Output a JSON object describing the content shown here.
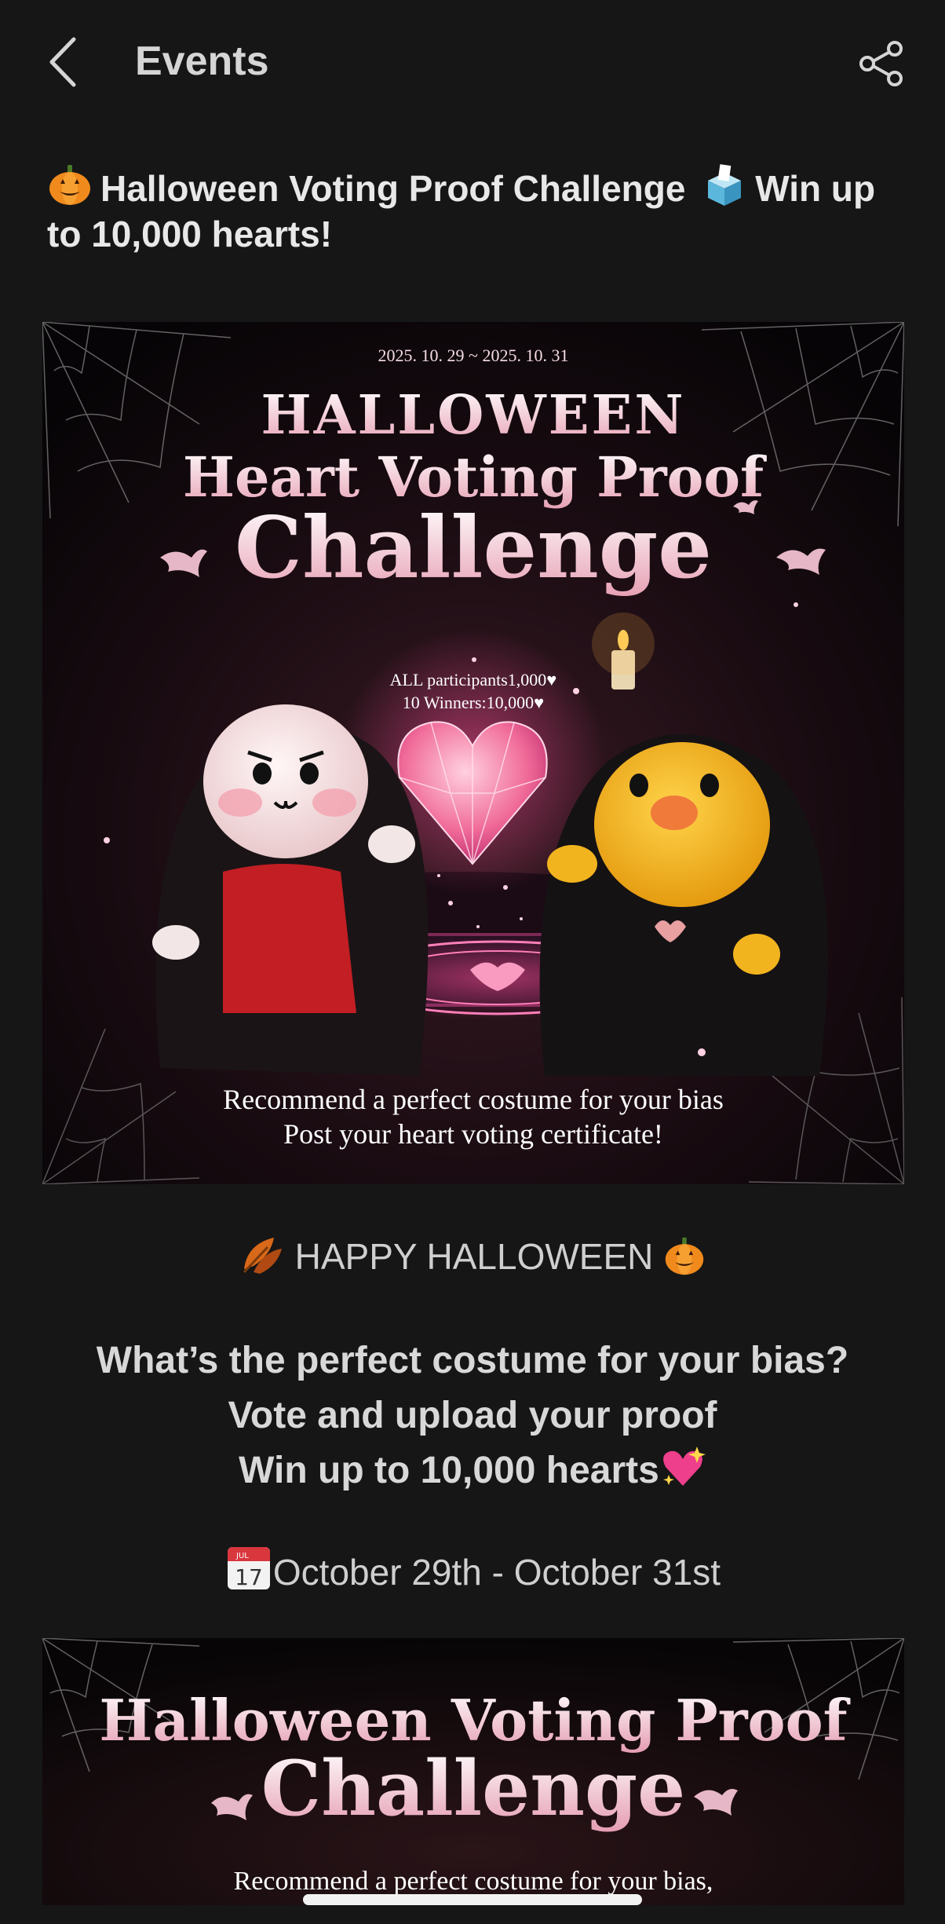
{
  "header": {
    "title": "Events",
    "back_icon": "chevron-left-icon",
    "share_icon": "share-icon"
  },
  "event": {
    "title_part1": "Halloween Voting Proof Challenge",
    "title_part2": "Win up to 10,000 hearts!",
    "title_emoji_1": "pumpkin-icon",
    "title_emoji_2": "ballot-box-icon"
  },
  "banner1": {
    "dates": "2025. 10. 29 ~ 2025. 10. 31",
    "line1": "HALLOWEEN",
    "line2": "Heart Voting Proof",
    "line3": "Challenge",
    "reward1": "ALL participants1,000♥",
    "reward2": "10 Winners:10,000♥",
    "caption1": "Recommend a perfect costume for your bias",
    "caption2": "Post your heart voting certificate!"
  },
  "body": {
    "happy": "HAPPY HALLOWEEN",
    "question1": "What’s the perfect costume for your bias?",
    "question2": "Vote and upload your proof",
    "question3": "Win up to 10,000 hearts",
    "calendar_month": "JUL",
    "calendar_day": "17",
    "dates": "October 29th - October 31st"
  },
  "banner2": {
    "line1": "Halloween Voting Proof",
    "line2": "Challenge",
    "caption": "Recommend a perfect costume for your bias,"
  },
  "colors": {
    "background": "#161616",
    "accent_pink": "#f07aa0",
    "pumpkin": "#f08a1c"
  }
}
